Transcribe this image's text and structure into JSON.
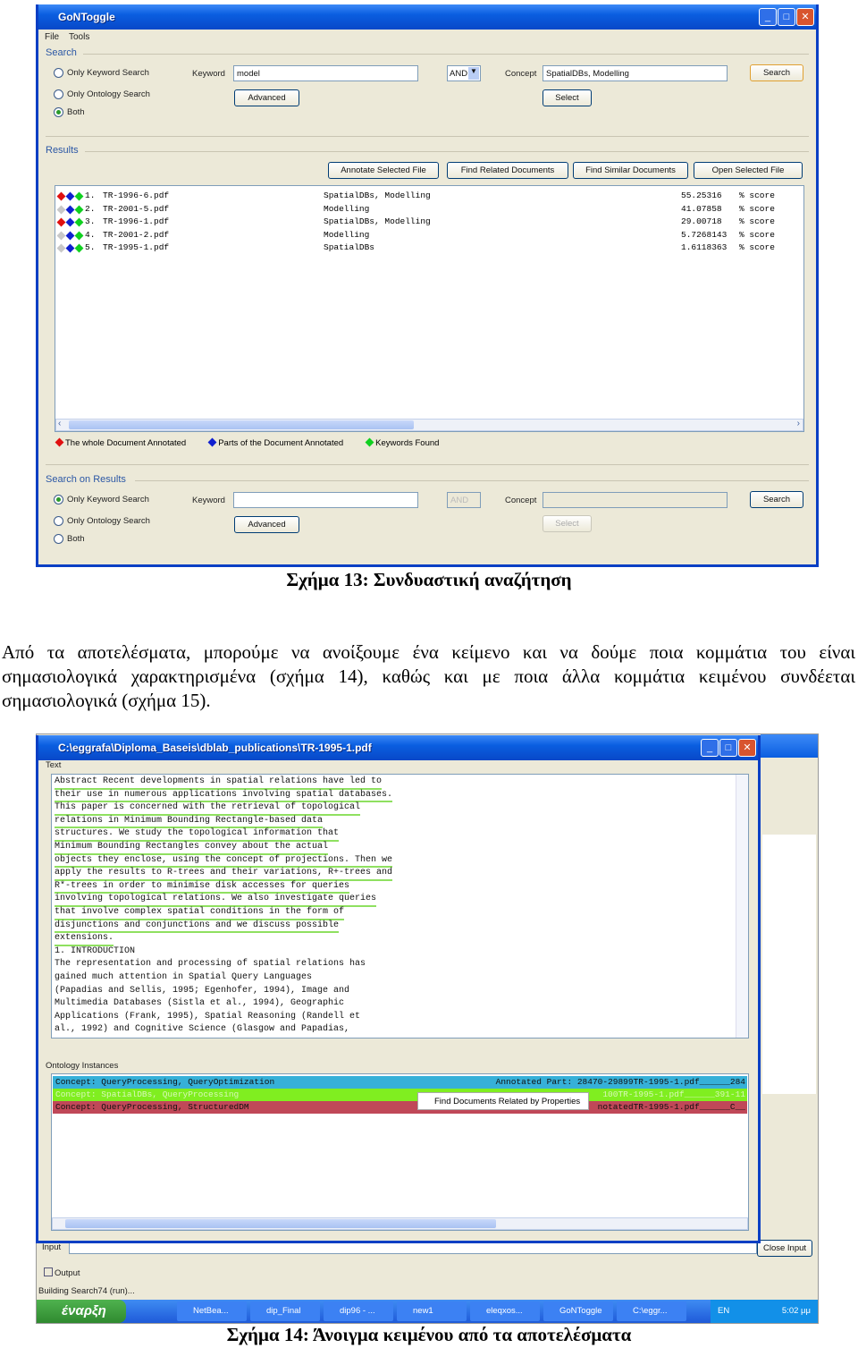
{
  "figure13": {
    "title": "GoNToggle",
    "menu": [
      "File",
      "Tools"
    ],
    "search": {
      "group": "Search",
      "radios": [
        "Only Keyword Search",
        "Only Ontology Search",
        "Both"
      ],
      "selected": 2,
      "keyword_label": "Keyword",
      "keyword_value": "model",
      "operator": "AND",
      "concept_label": "Concept",
      "concept_value": "SpatialDBs, Modelling",
      "search_button": "Search",
      "advanced_button": "Advanced",
      "select_button": "Select"
    },
    "results": {
      "group": "Results",
      "buttons": [
        "Annotate Selected File",
        "Find Related Documents",
        "Find Similar Documents",
        "Open Selected File"
      ],
      "rows": [
        {
          "index": "1.",
          "file": "TR-1996-6.pdf",
          "concepts": "SpatialDBs, Modelling",
          "score": "55.25316",
          "unit": "% score",
          "markers": [
            "#e01010",
            "#1020d0",
            "#10d020"
          ]
        },
        {
          "index": "2.",
          "file": "TR-2001-5.pdf",
          "concepts": "Modelling",
          "score": "41.07858",
          "unit": "% score",
          "markers": [
            "#c8c8c8",
            "#1020d0",
            "#10d020"
          ]
        },
        {
          "index": "3.",
          "file": "TR-1996-1.pdf",
          "concepts": "SpatialDBs, Modelling",
          "score": "29.00718",
          "unit": "% score",
          "markers": [
            "#e01010",
            "#1020d0",
            "#10d020"
          ]
        },
        {
          "index": "4.",
          "file": "TR-2001-2.pdf",
          "concepts": "Modelling",
          "score": "5.7268143",
          "unit": "% score",
          "markers": [
            "#c8c8c8",
            "#1020d0",
            "#10d020"
          ]
        },
        {
          "index": "5.",
          "file": "TR-1995-1.pdf",
          "concepts": "SpatialDBs",
          "score": "1.6118363",
          "unit": "% score",
          "markers": [
            "#c8c8c8",
            "#1020d0",
            "#10d020"
          ]
        }
      ],
      "legend": [
        {
          "label": "The whole Document Annotated",
          "color": "#e01010"
        },
        {
          "label": "Parts of the Document Annotated",
          "color": "#1020d0"
        },
        {
          "label": "Keywords Found",
          "color": "#10d020"
        }
      ]
    },
    "search_on_results": {
      "group": "Search on Results",
      "radios": [
        "Only Keyword Search",
        "Only Ontology Search",
        "Both"
      ],
      "selected": 0,
      "keyword_label": "Keyword",
      "keyword_value": "",
      "operator": "AND",
      "concept_label": "Concept",
      "concept_value": "",
      "search_button": "Search",
      "advanced_button": "Advanced",
      "select_button": "Select"
    },
    "caption": "Σχήμα 13: Συνδυαστική αναζήτηση"
  },
  "paragraph": "Από τα αποτελέσματα, μπορούμε να ανοίξουμε ένα κείμενο και να δούμε ποια κομμάτια του είναι σημασιολογικά χαρακτηρισμένα (σχήμα 14), καθώς και με ποια άλλα κομμάτια κειμένου συνδέεται σημασιολογικά (σχήμα 15).",
  "figure14": {
    "title": "C:\\eggrafa\\Diploma_Baseis\\dblab_publications\\TR-1995-1.pdf",
    "text_group": "Text",
    "text_lines": [
      {
        "t": "Abstract Recent developments in spatial relations have led to",
        "annotated": true
      },
      {
        "t": "their use in numerous applications involving spatial databases.",
        "annotated": true
      },
      {
        "t": "This paper is concerned with the retrieval of topological",
        "annotated": true
      },
      {
        "t": "relations in Minimum Bounding Rectangle-based data",
        "annotated": true
      },
      {
        "t": "structures. We study the topological information that",
        "annotated": true
      },
      {
        "t": "Minimum Bounding Rectangles convey about the actual",
        "annotated": true
      },
      {
        "t": "objects they enclose, using the concept of projections. Then we",
        "annotated": true
      },
      {
        "t": "apply the results to R-trees and their variations, R+-trees and",
        "annotated": true
      },
      {
        "t": "R*-trees in order to minimise disk accesses for queries",
        "annotated": true
      },
      {
        "t": "involving topological relations. We also investigate queries",
        "annotated": true
      },
      {
        "t": "that involve complex spatial conditions in the form of",
        "annotated": true
      },
      {
        "t": "disjunctions and conjunctions and we discuss possible",
        "annotated": true
      },
      {
        "t": "extensions.",
        "annotated": true
      },
      {
        "t": "1. INTRODUCTION",
        "annotated": false
      },
      {
        "t": "The representation and processing of spatial relations has",
        "annotated": false
      },
      {
        "t": "gained much attention in Spatial Query Languages",
        "annotated": false
      },
      {
        "t": "(Papadias and Sellis, 1995; Egenhofer, 1994), Image and",
        "annotated": false
      },
      {
        "t": "Multimedia Databases (Sistla et al., 1994), Geographic",
        "annotated": false
      },
      {
        "t": "Applications (Frank, 1995), Spatial Reasoning (Randell et",
        "annotated": false
      },
      {
        "t": "al., 1992) and Cognitive Science (Glasgow and Papadias,",
        "annotated": false
      }
    ],
    "ontology_group": "Ontology Instances",
    "instances": [
      {
        "concept": "Concept: QueryProcessing, QueryOptimization",
        "part": "Annotated Part: 28470-29899TR-1995-1.pdf______284",
        "color": "#36b0d8",
        "text": "#111"
      },
      {
        "concept": "Concept: SpatialDBs, QueryProcessing",
        "part": "100TR-1995-1.pdf______391-11",
        "color": "#80ee20",
        "text": "#d8f8b8"
      },
      {
        "concept": "Concept: QueryProcessing, StructuredDM",
        "part": "notatedTR-1995-1.pdf______C__",
        "color": "#c04858",
        "text": "#111"
      }
    ],
    "popup": "Find Documents Related by Properties",
    "input_label": "Input",
    "close_input": "Close Input",
    "output_label": "Output",
    "status": "Building Search74 (run)...",
    "taskbar": {
      "start": "έναρξη",
      "tasks": [
        "NetBea...",
        "dip_Final",
        "dip96 - ...",
        "new1",
        "eleqxos...",
        "GoNToggle",
        "C:\\eggr..."
      ],
      "lang": "EN",
      "clock": "5:02 μμ"
    },
    "caption": "Σχήμα 14: Άνοιγμα κειμένου από τα αποτελέσματα"
  }
}
